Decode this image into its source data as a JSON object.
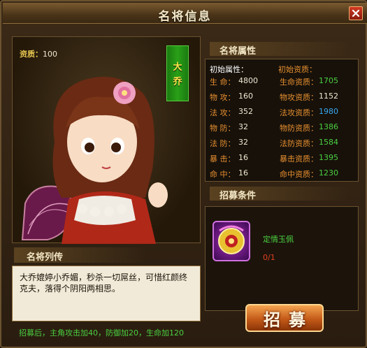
{
  "window": {
    "title": "名将信息",
    "close_icon": "close-icon"
  },
  "portrait": {
    "aptitude_label": "资质：",
    "aptitude_value": "100",
    "name_chars": [
      "大",
      "乔"
    ]
  },
  "biography": {
    "header": "名将列传",
    "text": "大乔媲婷小乔媚，秒杀一切屌丝，可惜红颜终克夫，落得个阴阳两相思。",
    "recruit_bonus": "招募后，主角攻击加40，防御加20，生命加120"
  },
  "attributes": {
    "header": "名将属性",
    "initial_label": "初始属性：",
    "initial_aptitude_label": "初始资质：",
    "rows": [
      {
        "name": "生  命：",
        "value": "4800",
        "apt_name": "生命资质：",
        "apt_value": "1705",
        "apt_color": "#4ad040"
      },
      {
        "name": "物  攻：",
        "value": "160",
        "apt_name": "物攻资质：",
        "apt_value": "1152",
        "apt_color": "#f0e8d0"
      },
      {
        "name": "法  攻：",
        "value": "352",
        "apt_name": "法攻资质：",
        "apt_value": "1980",
        "apt_color": "#38a8f0"
      },
      {
        "name": "物  防：",
        "value": "32",
        "apt_name": "物防资质：",
        "apt_value": "1386",
        "apt_color": "#4ad040"
      },
      {
        "name": "法  防：",
        "value": "32",
        "apt_name": "法防资质：",
        "apt_value": "1584",
        "apt_color": "#4ad040"
      },
      {
        "name": "暴  击：",
        "value": "16",
        "apt_name": "暴击资质：",
        "apt_value": "1395",
        "apt_color": "#4ad040"
      },
      {
        "name": "命  中：",
        "value": "16",
        "apt_name": "命中资质：",
        "apt_value": "1230",
        "apt_color": "#4ad040"
      }
    ]
  },
  "recruit": {
    "header": "招募条件",
    "item_icon": "jade-pendant-icon",
    "item_name": "定情玉佩",
    "item_count": "0/1",
    "button_label": "招募"
  }
}
